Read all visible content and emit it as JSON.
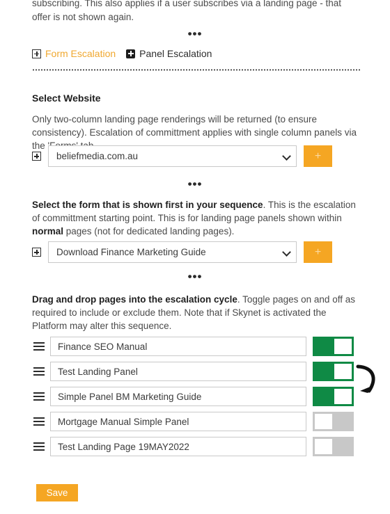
{
  "intro": {
    "paragraph": "subscribing. This also applies if a user subscribes via a landing page - that offer is not shown again."
  },
  "separator": {
    "dots": "•••"
  },
  "tabs": [
    {
      "label": "Form Escalation",
      "icon": "plus-square-outline-icon",
      "active": true
    },
    {
      "label": "Panel Escalation",
      "icon": "plus-square-solid-icon",
      "active": false
    }
  ],
  "website_section": {
    "heading": "Select Website",
    "description": "Only two-column landing page renderings will be returned (to ensure consistency). Escalation of committment applies with single column panels via the 'Forms' tab.",
    "expand_icon": "plus-square-outline-icon",
    "select_value": "beliefmedia.com.au",
    "add_button_label": "+"
  },
  "form_section": {
    "description_bold_1": "Select the form that is shown first in your sequence",
    "description_rest_1": ". This is the escalation of committment starting point. This is for landing page panels shown within ",
    "description_bold_2": "normal",
    "description_rest_2": " pages (not for dedicated landing pages).",
    "expand_icon": "plus-square-outline-icon",
    "select_value": "Download Finance Marketing Guide",
    "add_button_label": "+"
  },
  "sequence_section": {
    "description_bold": "Drag and drop pages into the escalation cycle",
    "description_rest": ". Toggle pages on and off as required to include or exclude them. Note that if Skynet is activated the Platform may alter this sequence.",
    "rows": [
      {
        "name": "Finance SEO Manual",
        "enabled": true
      },
      {
        "name": "Test Landing Panel",
        "enabled": true
      },
      {
        "name": "Simple Panel BM Marketing Guide",
        "enabled": true
      },
      {
        "name": "Mortgage Manual Simple Panel",
        "enabled": false
      },
      {
        "name": "Test Landing Page 19MAY2022",
        "enabled": false
      }
    ],
    "cycle_icon": "cycle-arrow-icon"
  },
  "footer": {
    "save_label": "Save"
  },
  "colors": {
    "accent_orange": "#f5a623",
    "active_tab_text": "#f0a830",
    "toggle_on_green": "#0f8a45",
    "toggle_off_gray": "#c8c8c8",
    "body_text": "#4a4a4a"
  }
}
